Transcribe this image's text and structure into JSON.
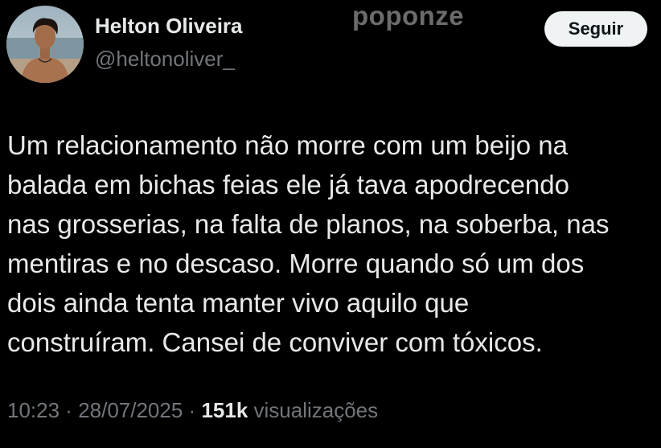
{
  "author": {
    "display_name": "Helton Oliveira",
    "handle": "@heltonoliver_",
    "avatar_icon": "profile-photo"
  },
  "watermark": "poponze",
  "follow_button": {
    "label": "Seguir"
  },
  "tweet": {
    "lines": [
      "Um relacionamento não morre com um beijo na",
      "balada em bichas feias ele já tava apodrecendo",
      "nas grosserias, na falta de planos, na soberba, nas",
      "mentiras e no descaso. Morre quando só um dos",
      "dois ainda tenta manter vivo aquilo que",
      "construíram. Cansei de conviver com tóxicos."
    ]
  },
  "meta": {
    "time": "10:23",
    "separator": " · ",
    "date": "28/07/2025",
    "views_count": "151k",
    "views_label": " visualizações"
  },
  "colors": {
    "background": "#000000",
    "primary_text": "#e7e9ea",
    "secondary_text": "#71767b",
    "button_bg": "#eff3f4",
    "button_text": "#0f1419"
  }
}
